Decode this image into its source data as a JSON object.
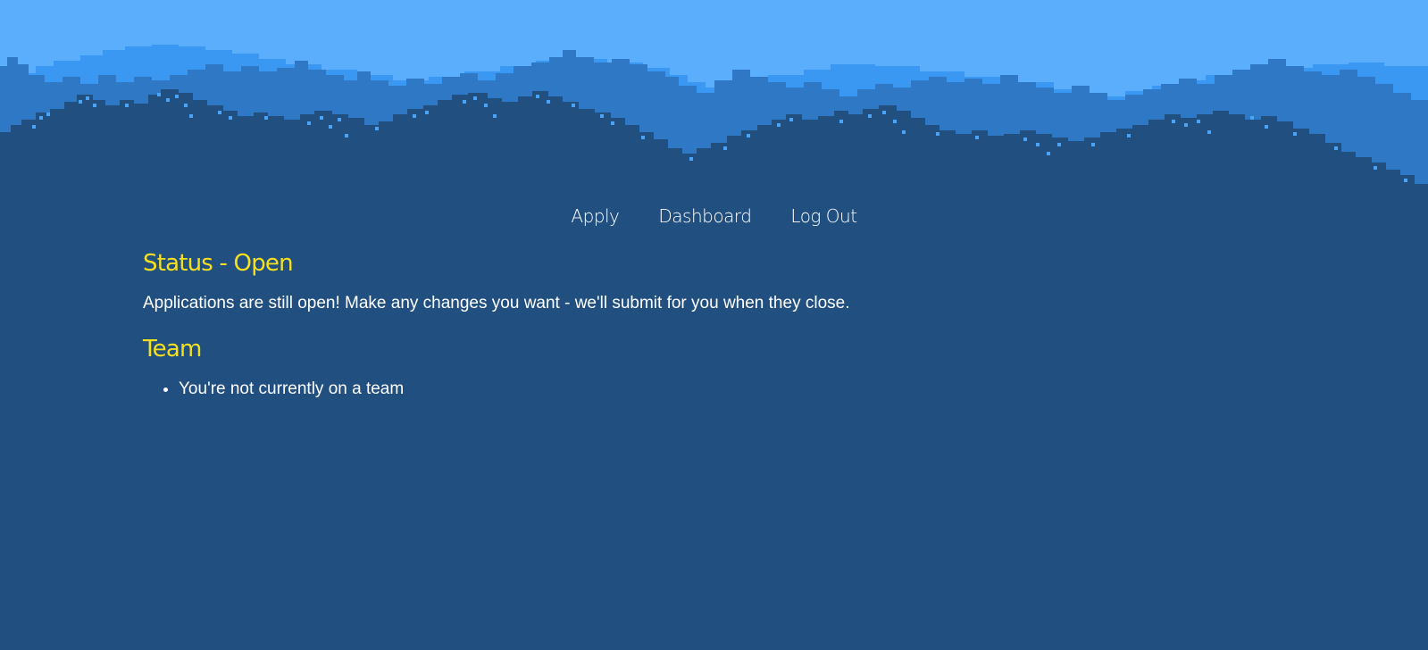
{
  "nav": {
    "items": [
      {
        "label": "Apply"
      },
      {
        "label": "Dashboard"
      },
      {
        "label": "Log Out"
      }
    ]
  },
  "status": {
    "heading": "Status - Open",
    "message": "Applications are still open! Make any changes you want - we'll submit for you when they close."
  },
  "team": {
    "heading": "Team",
    "items": [
      "You're not currently on a team"
    ]
  },
  "colors": {
    "sky": "#5aaefb",
    "far_hills": "#3a98f2",
    "mid_hills": "#2f78c6",
    "ground": "#214f80",
    "heading": "#f5e020",
    "text": "#ffffff",
    "sparkle": "#4aa3f5"
  }
}
